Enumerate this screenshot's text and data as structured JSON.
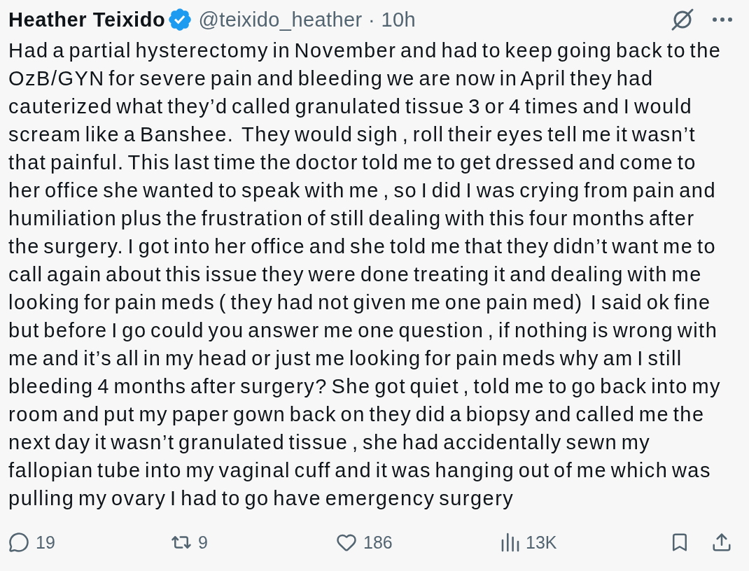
{
  "author": {
    "name": "Heather Teixido",
    "verified": true,
    "handle": "@teixido_heather",
    "separator": "·",
    "time": "10h"
  },
  "body": "Had a partial hysterectomy in November and had to keep going back to the OzB/GYN for severe pain and bleeding we are now in April they had cauterized what they’d called granulated tissue 3 or 4 times and I would scream like a Banshee.  They would sigh , roll their eyes tell me it wasn’t that painful. This last time the doctor told me to get dressed and come to her office she wanted to speak with me , so I did I was crying from pain and humiliation plus the frustration of still dealing with this four months after the surgery. I got into her office and she told me that they didn’t want me to call again about this issue they were done treating it and dealing with me looking for pain meds ( they had not given me one pain med)  I said ok fine but before I go could you answer me one question , if nothing is wrong with me and it’s all in my head or just me looking for pain meds why am I still bleeding 4 months after surgery? She got quiet , told me to go back into my room and put my paper gown back on they did a biopsy and called me the next day it wasn’t granulated tissue , she had accidentally sewn my fallopian tube into my vaginal cuff and it was hanging out of me which was pulling my ovary I had to go have emergency surgery",
  "actions": [
    {
      "kind": "reply",
      "count": "19"
    },
    {
      "kind": "repost",
      "count": "9"
    },
    {
      "kind": "like",
      "count": "186"
    },
    {
      "kind": "views",
      "count": "13K"
    },
    {
      "kind": "bookmark"
    },
    {
      "kind": "share"
    }
  ]
}
